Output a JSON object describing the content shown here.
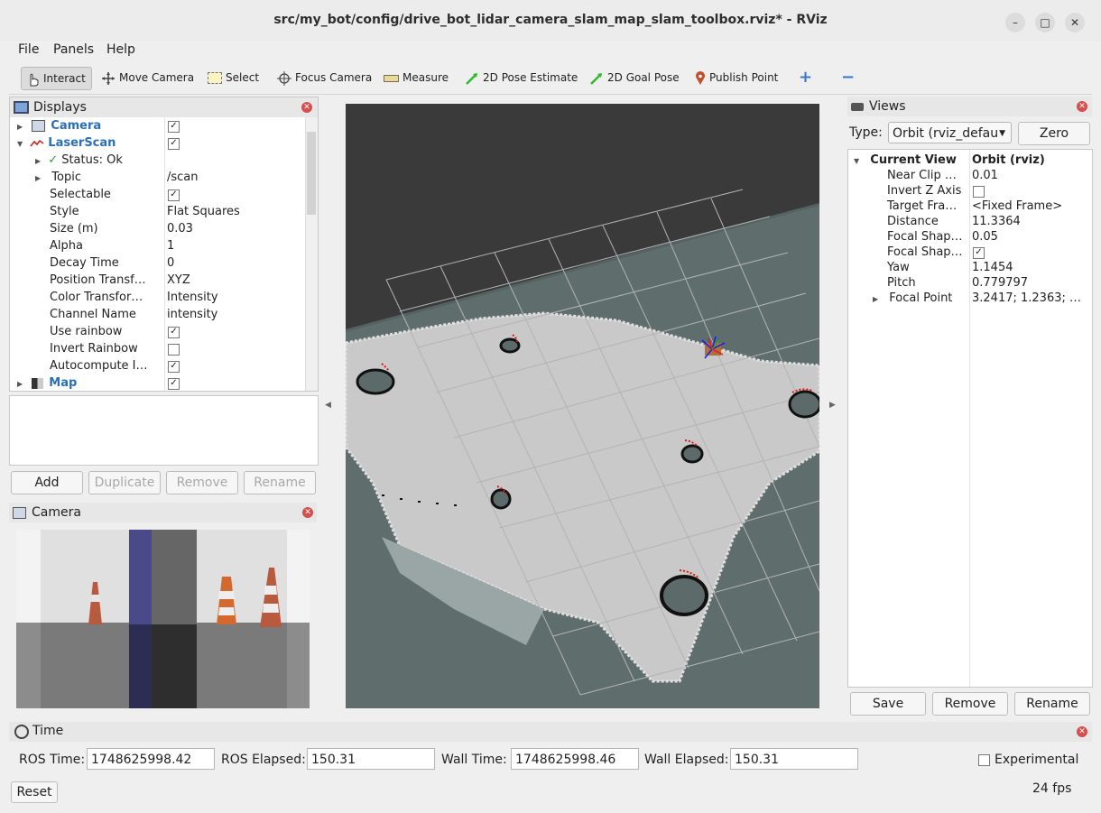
{
  "window": {
    "title": "src/my_bot/config/drive_bot_lidar_camera_slam_map_slam_toolbox.rviz* - RViz",
    "minimize": "–",
    "maximize": "□",
    "close": "✕"
  },
  "menu": {
    "file": "File",
    "panels": "Panels",
    "help": "Help"
  },
  "toolbar": {
    "interact": "Interact",
    "move_camera": "Move Camera",
    "select": "Select",
    "focus_camera": "Focus Camera",
    "measure": "Measure",
    "pose_estimate": "2D Pose Estimate",
    "goal_pose": "2D Goal Pose",
    "publish_point": "Publish Point"
  },
  "displays": {
    "title": "Displays",
    "rows": [
      {
        "label": "Camera",
        "value": "",
        "checked": true
      },
      {
        "label": "LaserScan",
        "value": "",
        "checked": true
      },
      {
        "label": "Status: Ok",
        "value": ""
      },
      {
        "label": "Topic",
        "value": "/scan"
      },
      {
        "label": "Selectable",
        "value": "",
        "checked": true
      },
      {
        "label": "Style",
        "value": "Flat Squares"
      },
      {
        "label": "Size (m)",
        "value": "0.03"
      },
      {
        "label": "Alpha",
        "value": "1"
      },
      {
        "label": "Decay Time",
        "value": "0"
      },
      {
        "label": "Position Transf…",
        "value": "XYZ"
      },
      {
        "label": "Color Transfor…",
        "value": "Intensity"
      },
      {
        "label": "Channel Name",
        "value": "intensity"
      },
      {
        "label": "Use rainbow",
        "value": "",
        "checked": true
      },
      {
        "label": "Invert Rainbow",
        "value": "",
        "checked": false
      },
      {
        "label": "Autocompute I…",
        "value": "",
        "checked": true
      },
      {
        "label": "Map",
        "value": "",
        "checked": true
      }
    ],
    "buttons": {
      "add": "Add",
      "duplicate": "Duplicate",
      "remove": "Remove",
      "rename": "Rename"
    }
  },
  "camera_panel": {
    "title": "Camera"
  },
  "views": {
    "title": "Views",
    "type_label": "Type:",
    "type_value": "Orbit (rviz_defau",
    "zero": "Zero",
    "header_key": "Current View",
    "header_value": "Orbit (rviz)",
    "props": [
      {
        "key": "Near Clip …",
        "value": "0.01"
      },
      {
        "key": "Invert Z Axis",
        "value": ""
      },
      {
        "key": "Target Fra…",
        "value": "<Fixed Frame>"
      },
      {
        "key": "Distance",
        "value": "11.3364"
      },
      {
        "key": "Focal Shap…",
        "value": "0.05"
      },
      {
        "key": "Focal Shap…",
        "value": ""
      },
      {
        "key": "Yaw",
        "value": "1.1454"
      },
      {
        "key": "Pitch",
        "value": "0.779797"
      },
      {
        "key": "Focal Point",
        "value": "3.2417; 1.2363; …"
      }
    ],
    "buttons": {
      "save": "Save",
      "remove": "Remove",
      "rename": "Rename"
    }
  },
  "time": {
    "title": "Time",
    "ros_time_label": "ROS Time:",
    "ros_time": "1748625998.42",
    "ros_elapsed_label": "ROS Elapsed:",
    "ros_elapsed": "150.31",
    "wall_time_label": "Wall Time:",
    "wall_time": "1748625998.46",
    "wall_elapsed_label": "Wall Elapsed:",
    "wall_elapsed": "150.31",
    "experimental": "Experimental",
    "reset": "Reset",
    "fps": "24 fps"
  }
}
